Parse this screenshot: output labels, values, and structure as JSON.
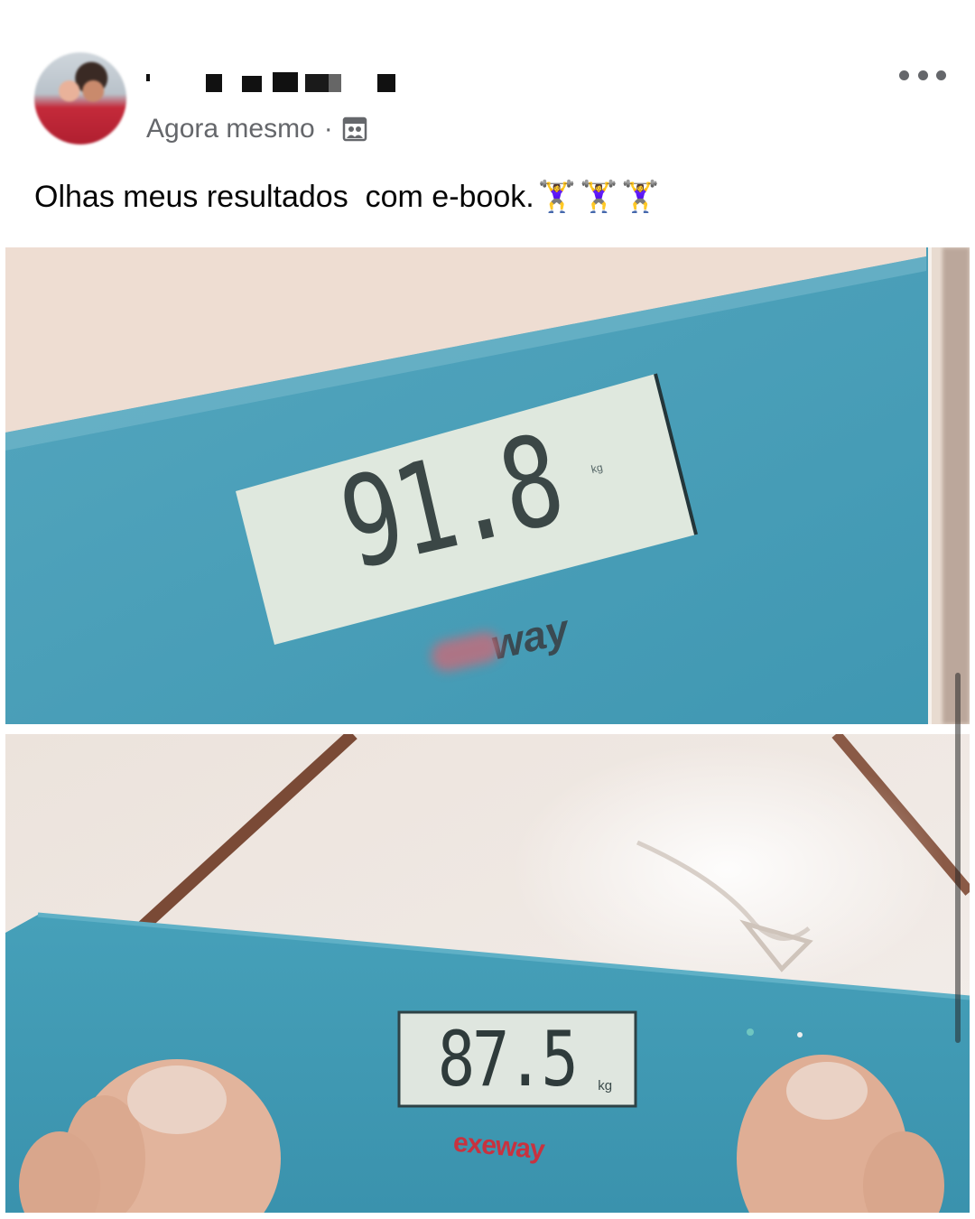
{
  "post": {
    "timestamp": "Agora mesmo",
    "separator": "·",
    "audience_icon": "group-audience-icon",
    "more_icon": "more-options-icon",
    "caption": "Olhas meus resultados  com e-book.",
    "caption_emojis": [
      "🏋️‍♀️",
      "🏋️‍♀️",
      "🏋️‍♀️"
    ]
  },
  "photos": [
    {
      "scale_reading": "91.8",
      "unit": "kg",
      "brand_partial": "way",
      "scale_color": "#4a9fb8"
    },
    {
      "scale_reading": "87.5",
      "unit": "kg",
      "brand": "exeway",
      "scale_color": "#3f98b3"
    }
  ],
  "colors": {
    "text_primary": "#050505",
    "text_secondary": "#65676b",
    "background": "#ffffff"
  }
}
